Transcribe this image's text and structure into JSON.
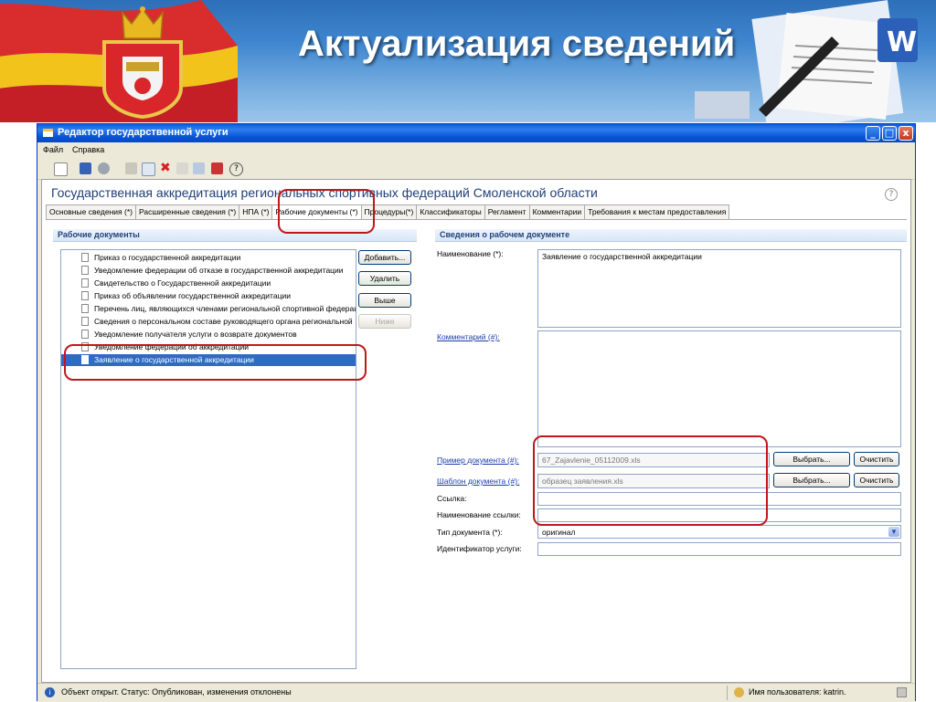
{
  "slide": {
    "title": "Актуализация сведений"
  },
  "window": {
    "title": "Редактор государственной услуги",
    "controls": [
      "_",
      "□",
      "x"
    ]
  },
  "menu": {
    "file": "Файл",
    "help": "Справка"
  },
  "header": {
    "service_title": "Государственная аккредитация региональных спортивных федераций Смоленской области",
    "help_glyph": "?"
  },
  "tabs": [
    {
      "label": "Основные сведения (*)"
    },
    {
      "label": "Расширенные сведения (*)"
    },
    {
      "label": "НПА (*)"
    },
    {
      "label": "Рабочие документы (*)"
    },
    {
      "label": "Процедуры(*)"
    },
    {
      "label": "Классификаторы"
    },
    {
      "label": "Регламент"
    },
    {
      "label": "Комментарии"
    },
    {
      "label": "Требования к местам предоставления"
    }
  ],
  "left": {
    "section_title": "Рабочие документы",
    "documents": [
      "Приказ о государственной аккредитации",
      "Уведомление федерации об отказе в государственной аккредитации",
      "Свидетельство о Государственной аккредитации",
      "Приказ об объявлении государственной аккредитации",
      "Перечень лиц, являющихся членами региональной спортивной федерации",
      "Сведения о персональном составе руководящего органа региональной",
      "Уведомление получателя услуги о возврате документов",
      "Уведомление федерации об аккредитации",
      "Заявление о государственной аккредитации"
    ],
    "buttons": {
      "add": "Добавить...",
      "delete": "Удалить",
      "up": "Выше",
      "down": "Ниже"
    }
  },
  "right": {
    "section_title": "Сведения о рабочем документе",
    "name_label": "Наименование (*):",
    "name_value": "Заявление о государственной аккредитации",
    "comment_label": "Комментарий (#):",
    "example_label": "Пример документа (#):",
    "example_value": "67_Zajavlenie_05112009.xls",
    "template_label": "Шаблон документа (#):",
    "template_value": "образец заявления.xls",
    "choose_label": "Выбрать...",
    "clear_label": "Очистить",
    "link_label": "Ссылка:",
    "link_name_label": "Наименование ссылки:",
    "doc_type_label": "Тип документа (*):",
    "doc_type_value": "оригинал",
    "service_id_label": "Идентификатор услуги:"
  },
  "status": {
    "text": "Объект открыт. Статус: Опубликован, изменения отклонены",
    "user": "Имя пользователя: katrin."
  },
  "colors": {
    "highlight": "#c0171c",
    "selection": "#316ac5",
    "banner": "#3f86cf"
  }
}
